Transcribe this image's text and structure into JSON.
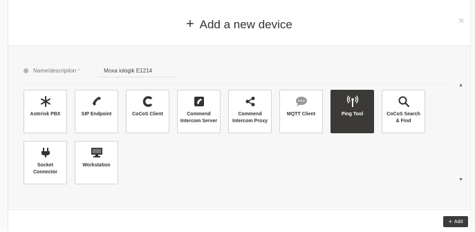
{
  "dialog": {
    "title_prefix": "+",
    "title": "Add a new device",
    "close_glyph": "×"
  },
  "form": {
    "name_label": "Name/description",
    "name_required_mark": "**",
    "name_value": "Moxa iologik E1214"
  },
  "devices": [
    {
      "label": "Asterisk PBX",
      "icon": "asterisk-icon",
      "selected": false
    },
    {
      "label": "SIP Endpoint",
      "icon": "phone-icon",
      "selected": false
    },
    {
      "label": "CoCoS Client",
      "icon": "cocos-icon",
      "selected": false
    },
    {
      "label": "Commend Intercom Server",
      "icon": "intercom-server-icon",
      "selected": false
    },
    {
      "label": "Commend Intercom Proxy",
      "icon": "share-icon",
      "selected": false
    },
    {
      "label": "MQTT Client",
      "icon": "chat-icon",
      "selected": false
    },
    {
      "label": "Ping Tool",
      "icon": "antenna-icon",
      "selected": true
    },
    {
      "label": "CoCoS Search & Find",
      "icon": "search-icon",
      "selected": false
    },
    {
      "label": "Socket Connector",
      "icon": "plug-icon",
      "selected": false
    },
    {
      "label": "Workstation",
      "icon": "monitor-icon",
      "selected": false
    }
  ],
  "scroll": {
    "up": "▲",
    "down": "▼"
  },
  "footer": {
    "add_prefix": "+",
    "add_label": "Add"
  }
}
